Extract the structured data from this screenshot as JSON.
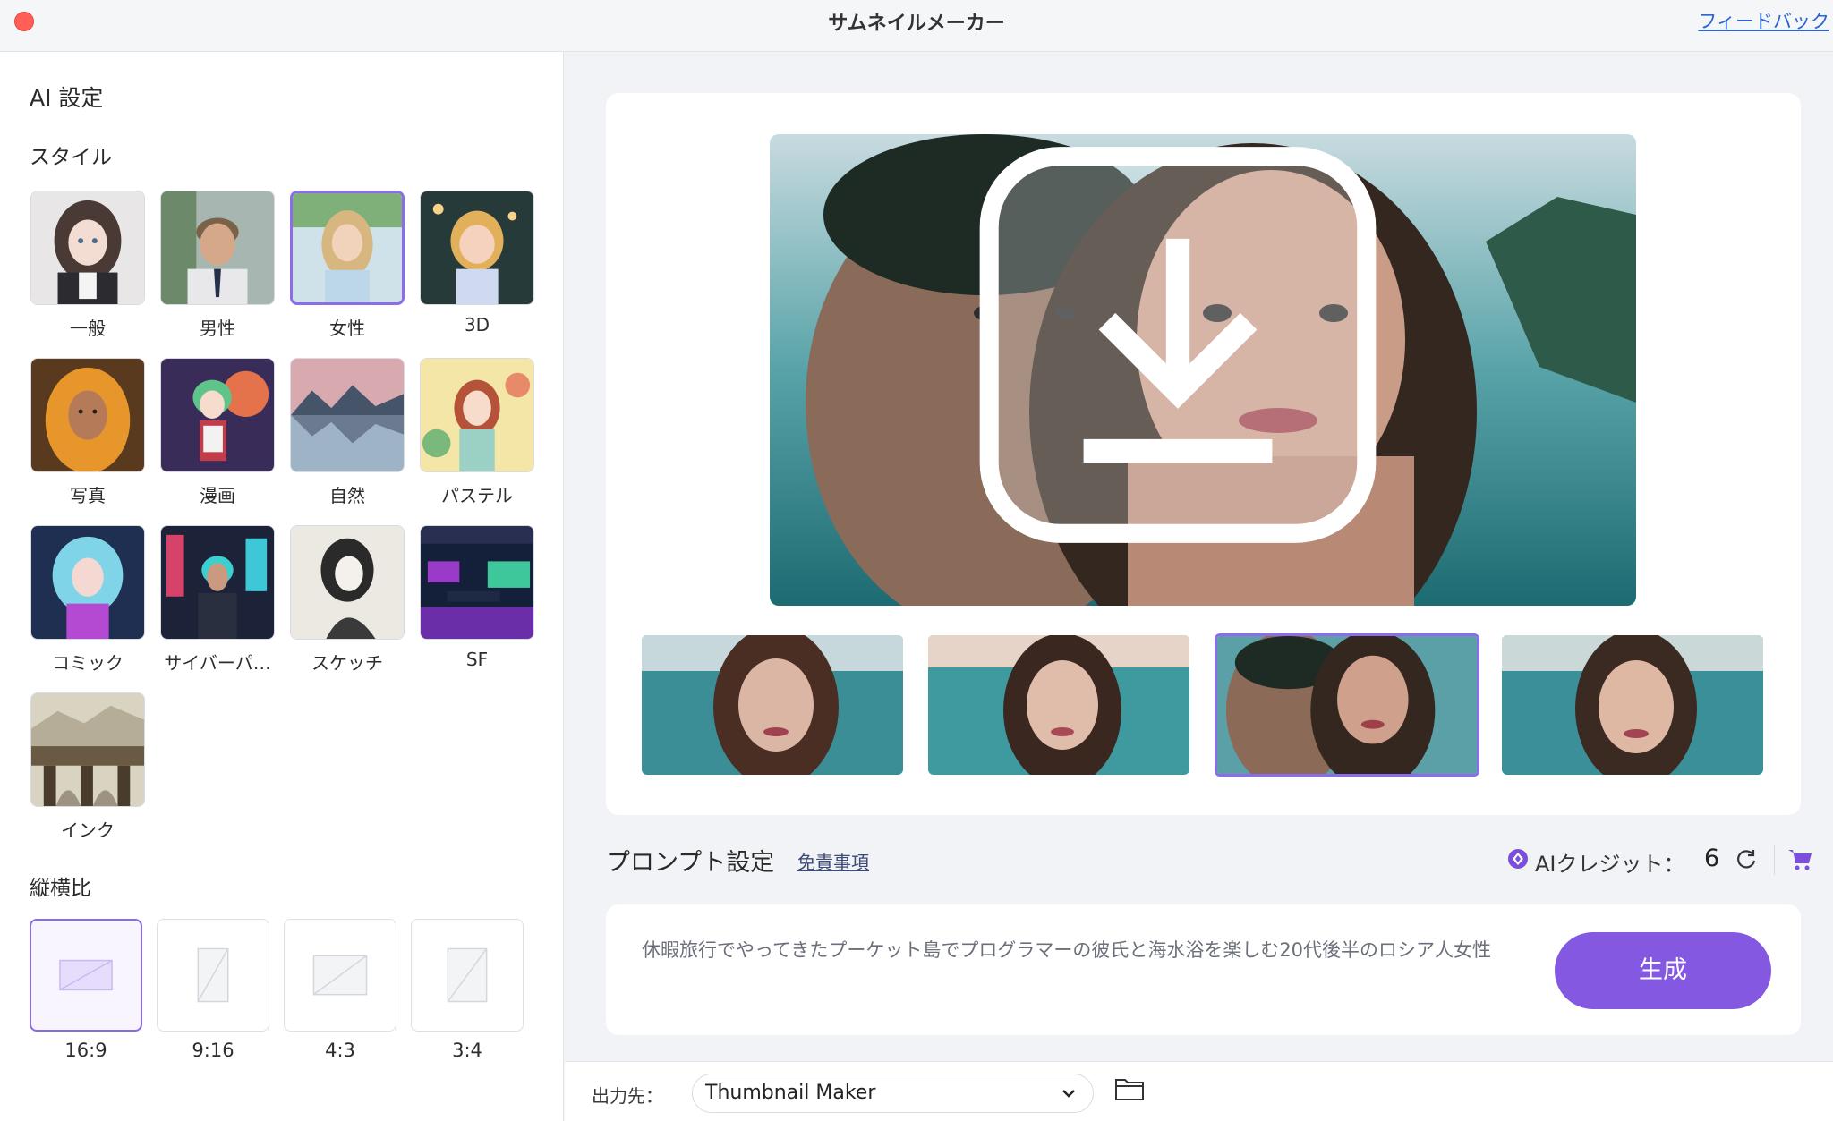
{
  "window": {
    "title": "サムネイルメーカー",
    "feedback_link": "フィードバック"
  },
  "left_panel": {
    "heading": "AI 設定",
    "style_heading": "スタイル",
    "styles": [
      {
        "label": "一般",
        "icon": "anime-girl-portrait",
        "selected": false
      },
      {
        "label": "男性",
        "icon": "man-portrait",
        "selected": false
      },
      {
        "label": "女性",
        "icon": "woman-portrait",
        "selected": true
      },
      {
        "label": "3D",
        "icon": "3d-character",
        "selected": false
      },
      {
        "label": "写真",
        "icon": "photo-portrait",
        "selected": false
      },
      {
        "label": "漫画",
        "icon": "manga-character",
        "selected": false
      },
      {
        "label": "自然",
        "icon": "mountain-lake",
        "selected": false
      },
      {
        "label": "パステル",
        "icon": "pastel-character",
        "selected": false
      },
      {
        "label": "コミック",
        "icon": "comic-character",
        "selected": false
      },
      {
        "label": "サイバーパ…",
        "icon": "cyberpunk-character",
        "selected": false
      },
      {
        "label": "スケッチ",
        "icon": "sketch-portrait",
        "selected": false
      },
      {
        "label": "SF",
        "icon": "scifi-interior",
        "selected": false
      },
      {
        "label": "インク",
        "icon": "ink-landscape",
        "selected": false
      }
    ],
    "aspect_heading": "縦横比",
    "aspect_ratios": [
      {
        "label": "16:9",
        "selected": true
      },
      {
        "label": "9:16",
        "selected": false
      },
      {
        "label": "4:3",
        "selected": false
      },
      {
        "label": "3:4",
        "selected": false
      }
    ]
  },
  "preview": {
    "main_image": "couple-in-sea-photo",
    "thumbnails": [
      {
        "image": "woman-in-sea-1",
        "selected": false
      },
      {
        "image": "woman-in-sea-2",
        "selected": false
      },
      {
        "image": "couple-in-sea",
        "selected": true
      },
      {
        "image": "woman-in-sea-3",
        "selected": false
      }
    ]
  },
  "prompt": {
    "heading": "プロンプト設定",
    "disclaimer": "免責事項",
    "credit_label": "AIクレジット：",
    "credit_value": "6",
    "text": "休暇旅行でやってきたプーケット島でプログラマーの彼氏と海水浴を楽しむ20代後半のロシア人女性",
    "generate_label": "生成"
  },
  "output": {
    "label": "出力先：",
    "folder": "Thumbnail Maker"
  },
  "colors": {
    "accent": "#8458e0",
    "close": "#ff5f57",
    "link": "#2c63d6"
  }
}
